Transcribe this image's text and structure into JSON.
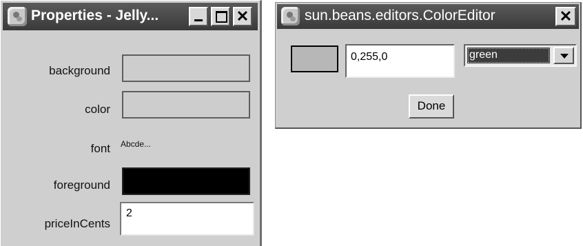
{
  "properties_window": {
    "title": "Properties - Jelly...",
    "properties": {
      "background": {
        "label": "background"
      },
      "color": {
        "label": "color"
      },
      "font": {
        "label": "font",
        "preview": "Abcde..."
      },
      "foreground": {
        "label": "foreground",
        "value_color": "#000000"
      },
      "priceInCents": {
        "label": "priceInCents",
        "value": "2"
      }
    }
  },
  "color_editor_window": {
    "title": "sun.beans.editors.ColorEditor",
    "close_glyph": "✕",
    "value": "0,255,0",
    "color_name": "green",
    "done_label": "Done"
  }
}
